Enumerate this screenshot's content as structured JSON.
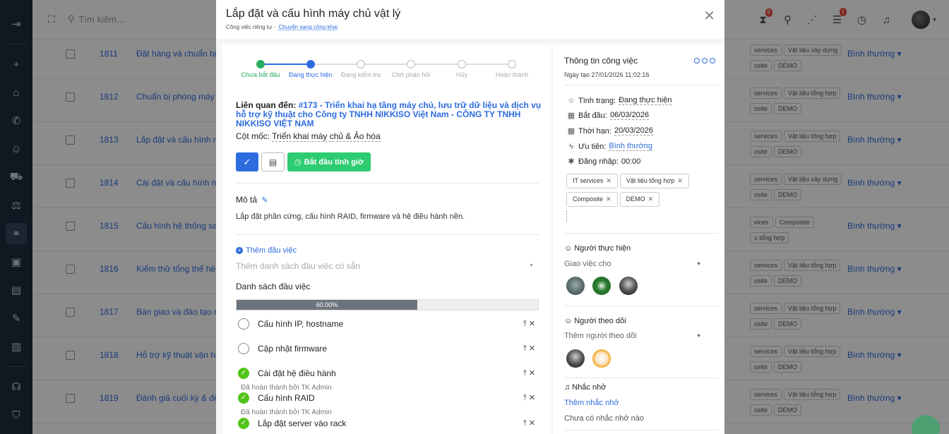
{
  "topbar": {
    "search_placeholder": "Tìm kiếm...",
    "badge_hourglass": "9",
    "badge_tasks": "1"
  },
  "background_rows": [
    {
      "id": "1811",
      "title": "Đặt hàng và chuẩn bị th",
      "tags": [
        "services",
        "Vật liệu xây dựng",
        "osite",
        "DEMO"
      ],
      "priority": "Bình thường"
    },
    {
      "id": "1812",
      "title": "Chuẩn bị phòng máy &",
      "tags": [
        "services",
        "Vật liệu tổng hợp",
        "osite",
        "DEMO"
      ],
      "priority": "Bình thường"
    },
    {
      "id": "1813",
      "title": "Lắp đặt và cấu hình má",
      "tags": [
        "services",
        "Vật liệu tổng hợp",
        "osite",
        "DEMO"
      ],
      "priority": "Bình thường"
    },
    {
      "id": "1814",
      "title": "Cài đặt và cấu hình nền",
      "tags": [
        "services",
        "Vật liệu xây dựng",
        "osite",
        "DEMO"
      ],
      "priority": "Bình thường"
    },
    {
      "id": "1815",
      "title": "Cấu hình hệ thống sao",
      "tags": [
        "vices",
        "Composite",
        "u tổng hợp"
      ],
      "priority": "Bình thường"
    },
    {
      "id": "1816",
      "title": "Kiểm thử tổng thể hệ th",
      "tags": [
        "services",
        "Vật liệu tổng hợp",
        "osite",
        "DEMO"
      ],
      "priority": "Bình thường"
    },
    {
      "id": "1817",
      "title": "Bàn giao và đào tạo ng",
      "tags": [
        "services",
        "Vật liệu tổng hợp",
        "osite",
        "DEMO"
      ],
      "priority": "Bình thường"
    },
    {
      "id": "1818",
      "title": "Hỗ trợ kỹ thuật vận hàn",
      "tags": [
        "services",
        "Vật liệu tổng hợp",
        "osite",
        "DEMO"
      ],
      "priority": "Bình thường"
    },
    {
      "id": "1819",
      "title": "Đánh giá cuối kỳ & đề x",
      "tags": [
        "services",
        "Vật liệu tổng hợp",
        "osite",
        "DEMO"
      ],
      "priority": "Bình thường"
    }
  ],
  "modal": {
    "title": "Lắp đặt và cấu hình máy chủ vật lý",
    "subtitle_prefix": "Công việc riêng tư -",
    "subtitle_link": "Chuyển sang công khai",
    "steps": [
      "Chưa bắt đầu",
      "Đang thực hiện",
      "Đang kiểm tra",
      "Chờ phản hồi",
      "Hủy",
      "Hoàn thành"
    ],
    "related_label": "Liên quan đến:",
    "related_link": "#173 - Triển khai hạ tầng máy chủ, lưu trữ dữ liệu và dịch vụ hỗ trợ kỹ thuật cho Công ty TNHH NIKKISO Việt Nam - CÔNG TY TNHH NIKKISO VIỆT NAM",
    "milestone_label": "Cột mốc:",
    "milestone_value": "Triển khai máy chủ & Ảo hóa",
    "timer_button": "Bắt đầu tính giờ",
    "description_heading": "Mô tả",
    "description": "Lắp đặt phần cứng, cấu hình RAID, firmware và hệ điều hành nền.",
    "add_task": "Thêm đầu việc",
    "preset_placeholder": "Thêm danh sách đầu việc có sẵn",
    "tasklist_heading": "Danh sách đầu việc",
    "progress_label": "60.00%",
    "progress_value": 0.6,
    "tasks": [
      {
        "name": "Cấu hình IP, hostname",
        "done": false,
        "by": ""
      },
      {
        "name": "Cập nhật firmware",
        "done": false,
        "by": ""
      },
      {
        "name": "Cài đặt hệ điều hành",
        "done": true,
        "by": "Đã hoàn thành bởi TK Admin"
      },
      {
        "name": "Cấu hình RAID",
        "done": true,
        "by": "Đã hoàn thành bởi TK Admin"
      },
      {
        "name": "Lắp đặt server vào rack",
        "done": true,
        "by": ""
      }
    ]
  },
  "info": {
    "title": "Thông tin công việc",
    "created": "Ngày tạo 27/01/2026 11:02:16",
    "status_label": "Tình trạng:",
    "status_value": "Đang thực hiện",
    "start_label": "Bắt đầu:",
    "start_value": "06/03/2026",
    "due_label": "Thời hạn:",
    "due_value": "20/03/2026",
    "priority_label": "Ưu tiên:",
    "priority_value": "Bình thường",
    "login_label": "Đăng nhập:",
    "login_value": "00:00",
    "tags": [
      "IT services",
      "Vật liệu tổng hợp",
      "Composite",
      "DEMO"
    ],
    "assignee_heading": "Người thực hiện",
    "assign_placeholder": "Giao việc cho",
    "follower_heading": "Người theo dõi",
    "follower_placeholder": "Thêm người theo dõi",
    "reminder_heading": "Nhắc nhở",
    "add_reminder": "Thêm nhắc nhở",
    "no_reminder": "Chưa có nhắc nhở nào"
  },
  "colors": {
    "primary": "#2d6cdf",
    "success": "#27ae60",
    "sidebar": "#1f2d3d"
  }
}
